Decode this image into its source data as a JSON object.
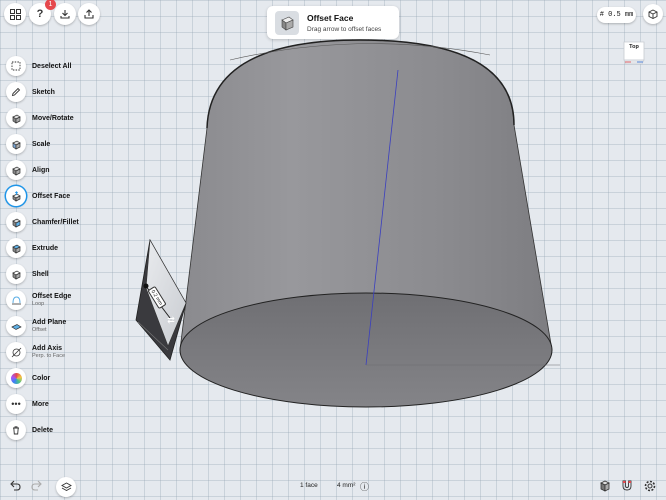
{
  "header": {
    "notification_count": "1",
    "hint": {
      "title": "Offset Face",
      "subtitle": "Drag arrow to offset faces"
    },
    "unit": "# 0.5 mm",
    "view_cube_label": "Top"
  },
  "toolbar": {
    "items": [
      {
        "label": "Deselect All",
        "sub": "",
        "icon": "deselect-icon"
      },
      {
        "label": "Sketch",
        "sub": "",
        "icon": "pencil-icon"
      },
      {
        "label": "Move/Rotate",
        "sub": "",
        "icon": "move-icon"
      },
      {
        "label": "Scale",
        "sub": "",
        "icon": "scale-icon"
      },
      {
        "label": "Align",
        "sub": "",
        "icon": "align-icon"
      },
      {
        "label": "Offset Face",
        "sub": "",
        "icon": "offset-face-icon",
        "active": true
      },
      {
        "label": "Chamfer/Fillet",
        "sub": "",
        "icon": "chamfer-icon"
      },
      {
        "label": "Extrude",
        "sub": "",
        "icon": "extrude-icon"
      },
      {
        "label": "Shell",
        "sub": "",
        "icon": "shell-icon"
      },
      {
        "label": "Offset Edge",
        "sub": "Loop",
        "icon": "offset-edge-icon"
      },
      {
        "label": "Add Plane",
        "sub": "Offset",
        "icon": "plane-icon"
      },
      {
        "label": "Add Axis",
        "sub": "Perp. to Face",
        "icon": "axis-icon"
      },
      {
        "label": "Color",
        "sub": "",
        "icon": "color-icon"
      },
      {
        "label": "More",
        "sub": "",
        "icon": "more-icon"
      },
      {
        "label": "Delete",
        "sub": "",
        "icon": "trash-icon"
      }
    ]
  },
  "canvas": {
    "offset_value": "0.2 mm",
    "arrow_glyph": "⇄"
  },
  "footer": {
    "selection_count": "1 face",
    "area": "4 mm²",
    "info_glyph": "ⓘ"
  },
  "colors": {
    "accent": "#1f95e8",
    "badge": "#e5484d",
    "cylinder_side": "#8e8e92",
    "cylinder_bottom": "#76767a",
    "axis_blue": "#3a3fbf"
  }
}
